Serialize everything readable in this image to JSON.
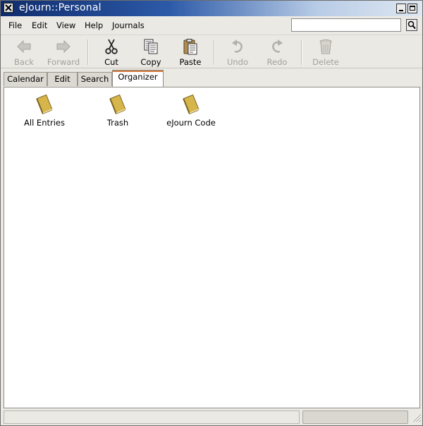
{
  "window": {
    "title": "eJourn::Personal"
  },
  "menu": {
    "file": "File",
    "edit": "Edit",
    "view": "View",
    "help": "Help",
    "journals": "Journals"
  },
  "search": {
    "value": "",
    "placeholder": ""
  },
  "toolbar": {
    "back": "Back",
    "forward": "Forward",
    "cut": "Cut",
    "copy": "Copy",
    "paste": "Paste",
    "undo": "Undo",
    "redo": "Redo",
    "delete": "Delete"
  },
  "tabs": [
    "Calendar",
    "Edit",
    "Search",
    "Organizer"
  ],
  "active_tab": "Organizer",
  "organizer": {
    "entries": [
      "All Entries",
      "Trash",
      "eJourn Code"
    ]
  },
  "status": {
    "text": "",
    "progress": 0
  },
  "colors": {
    "active_tab_accent": "#d4793b",
    "title_bar_start": "#0f2c6c",
    "journal_icon": "#d6b54a"
  },
  "icons": [
    "close-icon",
    "minimize-icon",
    "maximize-icon",
    "search-icon",
    "back-arrow-icon",
    "forward-arrow-icon",
    "scissors-icon",
    "copy-icon",
    "clipboard-icon",
    "undo-icon",
    "redo-icon",
    "trash-can-icon",
    "journal-book-icon",
    "resize-grip-icon"
  ]
}
